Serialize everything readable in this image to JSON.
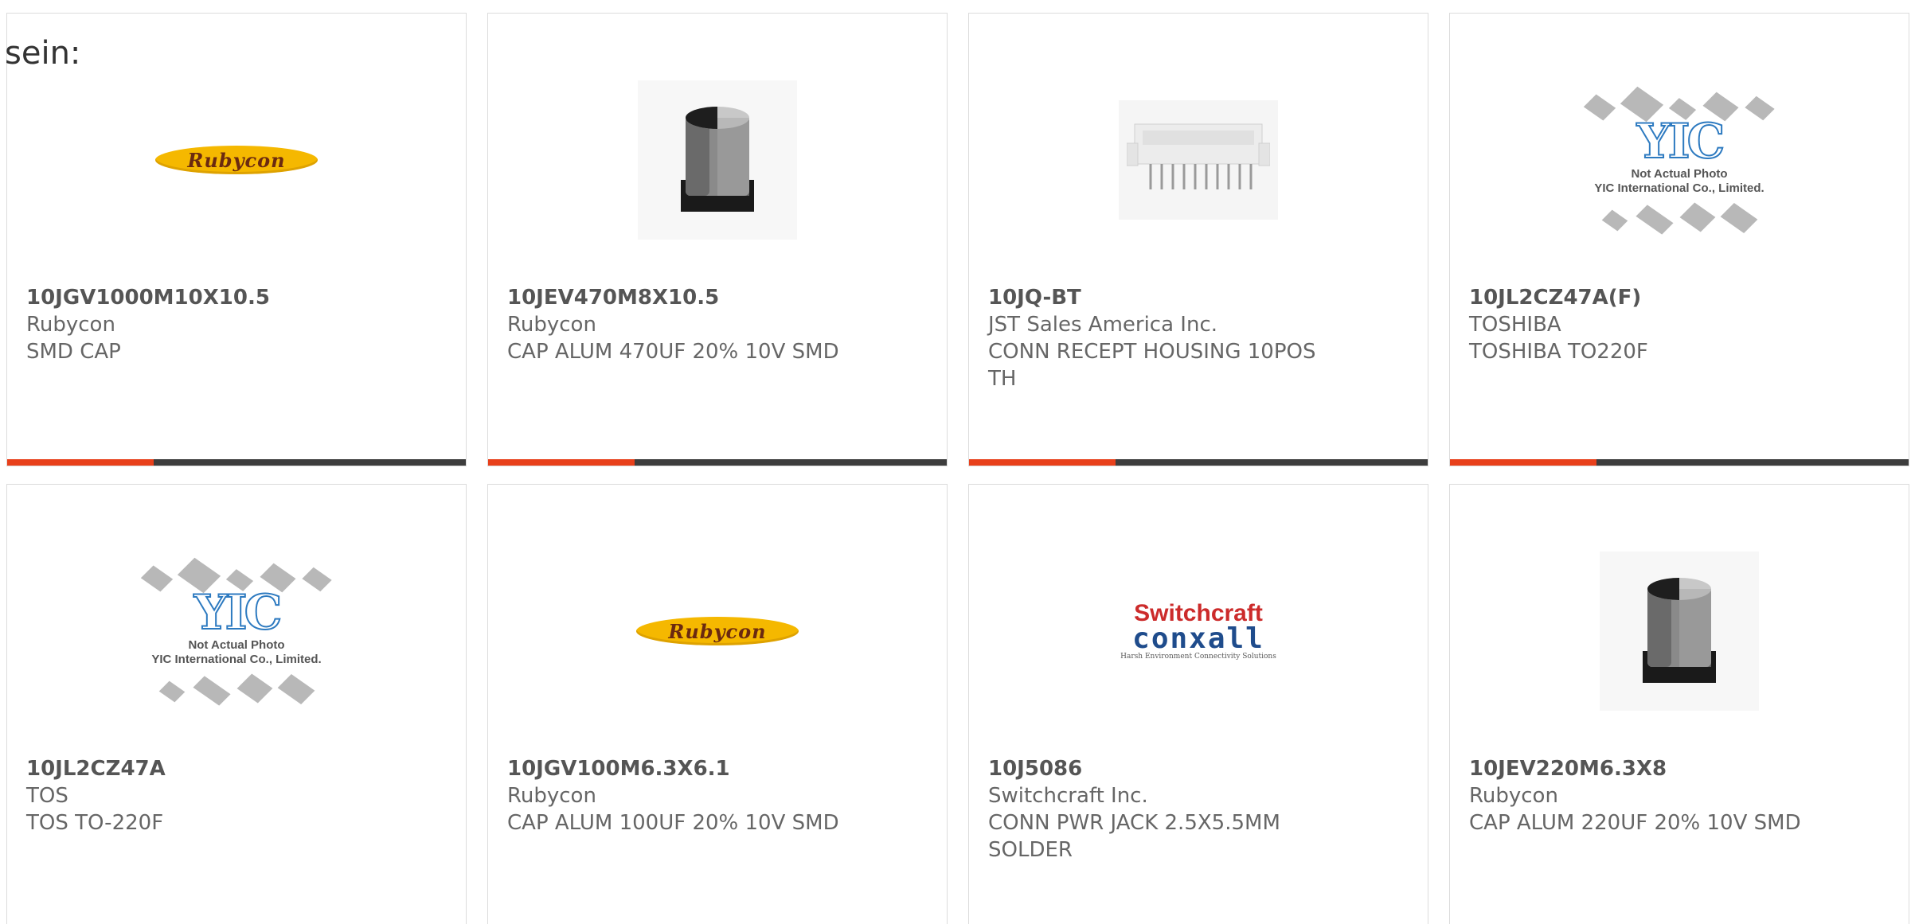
{
  "heading_label": "sein:",
  "colors": {
    "accent": "#e8401b",
    "bar": "#3d3d3d",
    "rubycon_yellow": "#f5b800",
    "switchcraft_red": "#cc2b2b",
    "conxall_blue": "#1f4c8c",
    "yic_blue": "#2d7ac0"
  },
  "products": [
    {
      "part_number": "10JGV1000M10X10.5",
      "manufacturer": "Rubycon",
      "description": "SMD CAP",
      "image": "rubycon-logo",
      "logo_text": "Rubycon"
    },
    {
      "part_number": "10JEV470M8X10.5",
      "manufacturer": "Rubycon",
      "description": "CAP ALUM 470UF 20% 10V SMD",
      "image": "capacitor-photo"
    },
    {
      "part_number": "10JQ-BT",
      "manufacturer": "JST Sales America Inc.",
      "description": "CONN RECEPT HOUSING 10POS TH",
      "image": "connector-photo"
    },
    {
      "part_number": "10JL2CZ47A(F)",
      "manufacturer": "TOSHIBA",
      "description": "TOSHIBA TO220F",
      "image": "yic-placeholder",
      "logo_text": "YIC",
      "caption_line1": "Not Actual Photo",
      "caption_line2": "YIC International Co., Limited."
    },
    {
      "part_number": "10JL2CZ47A",
      "manufacturer": "TOS",
      "description": "TOS TO-220F",
      "image": "yic-placeholder",
      "logo_text": "YIC",
      "caption_line1": "Not Actual Photo",
      "caption_line2": "YIC International Co., Limited."
    },
    {
      "part_number": "10JGV100M6.3X6.1",
      "manufacturer": "Rubycon",
      "description": "CAP ALUM 100UF 20% 10V SMD",
      "image": "rubycon-logo",
      "logo_text": "Rubycon"
    },
    {
      "part_number": "10J5086",
      "manufacturer": "Switchcraft Inc.",
      "description": "CONN PWR JACK 2.5X5.5MM SOLDER",
      "image": "switchcraft-logo",
      "logo_top": "Switchcraft",
      "logo_mid": "conxall",
      "logo_bot": "Harsh Environment Connectivity Solutions"
    },
    {
      "part_number": "10JEV220M6.3X8",
      "manufacturer": "Rubycon",
      "description": "CAP ALUM 220UF 20% 10V SMD",
      "image": "capacitor-photo"
    }
  ]
}
